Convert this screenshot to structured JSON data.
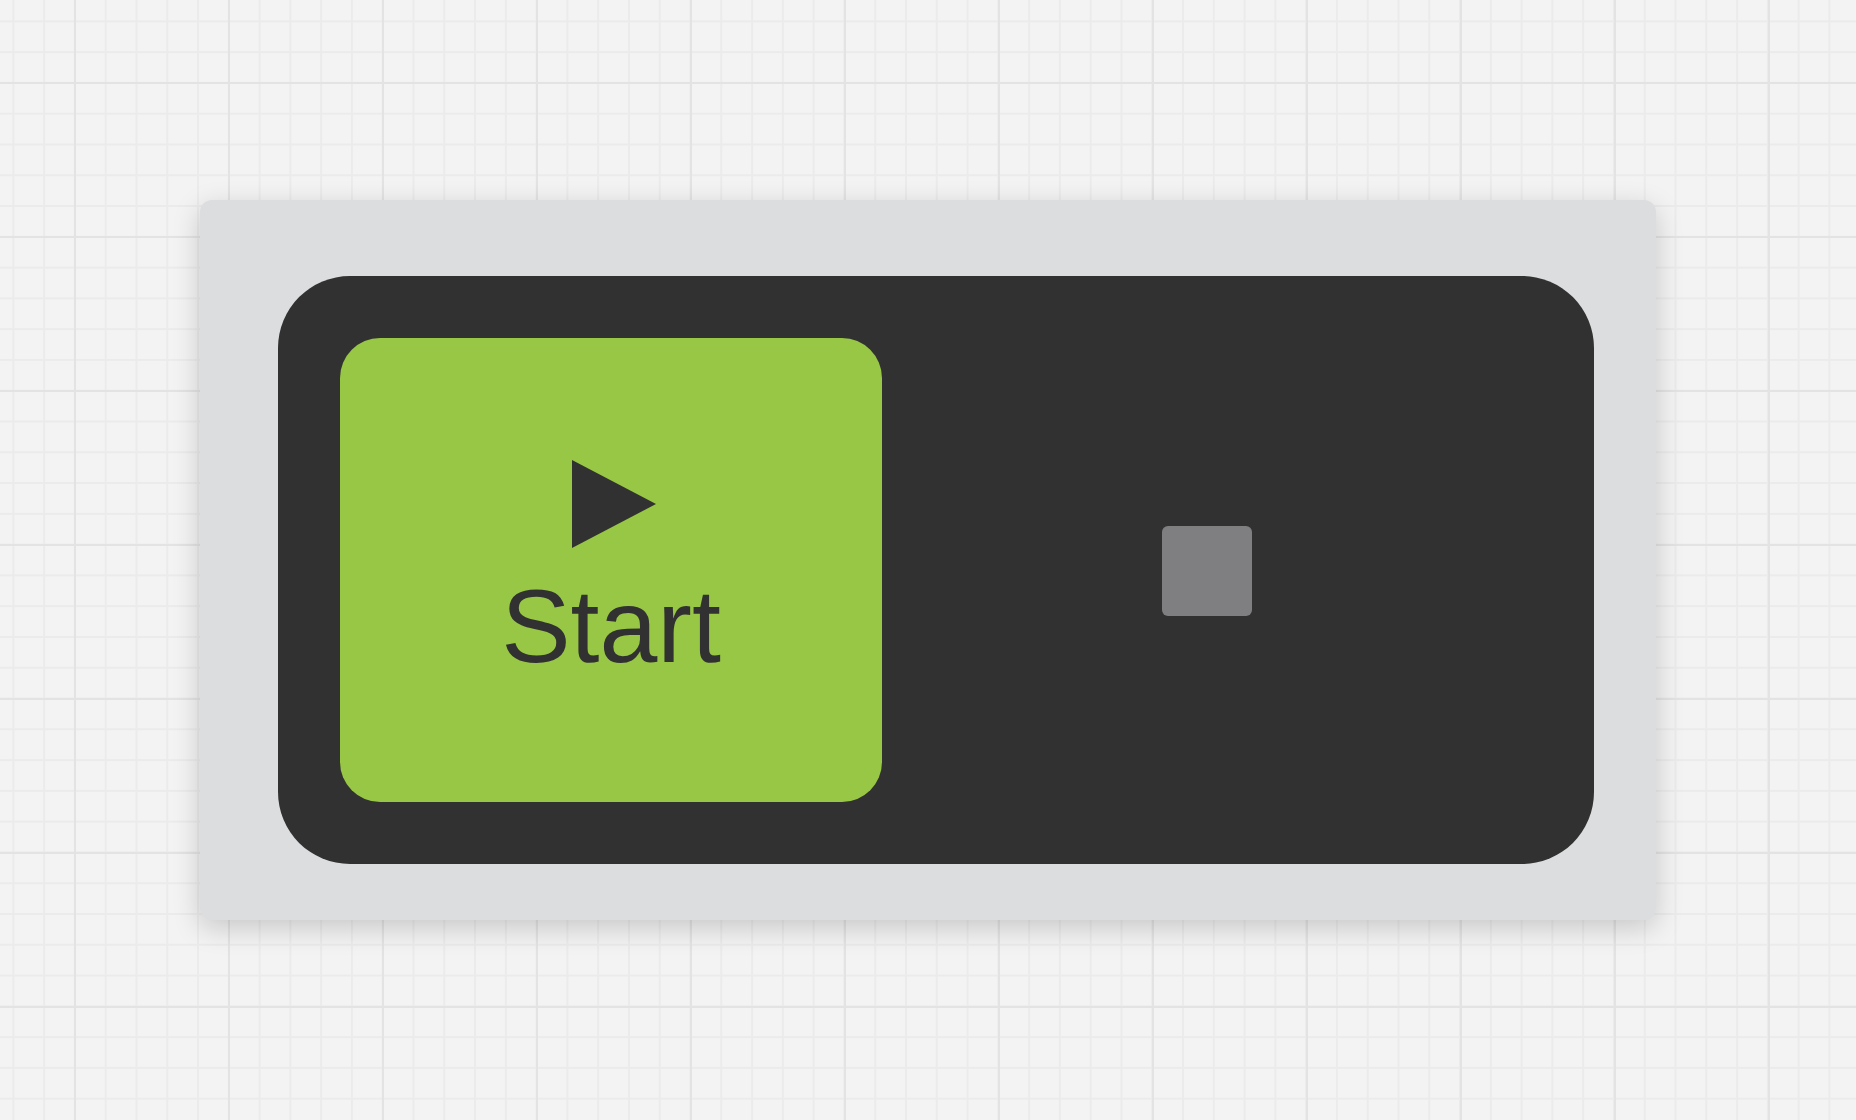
{
  "controls": [
    {
      "kind": "start",
      "label": "Start",
      "selected": true
    },
    {
      "kind": "stop",
      "selected": false
    }
  ]
}
